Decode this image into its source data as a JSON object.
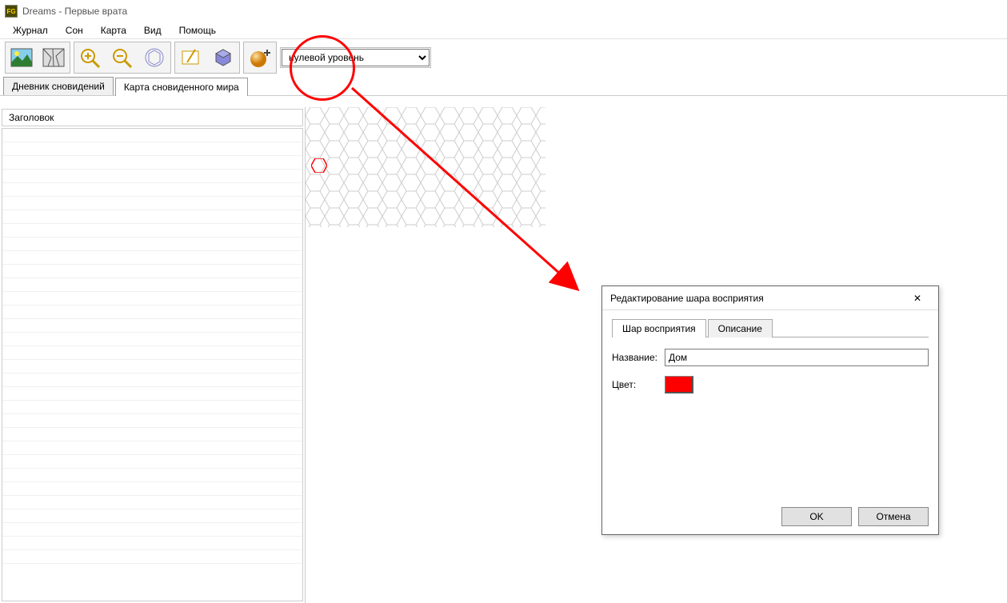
{
  "window": {
    "title": "Dreams - Первые врата"
  },
  "menu": {
    "items": [
      "Журнал",
      "Сон",
      "Карта",
      "Вид",
      "Помощь"
    ]
  },
  "toolbar": {
    "icons": [
      "picture-icon",
      "cracked-icon",
      "zoom-in-icon",
      "zoom-out-icon",
      "hex-grid-icon",
      "edit-icon",
      "hex-3d-icon",
      "sphere-add-icon"
    ],
    "level_dropdown": {
      "selected": "нулевой уровень"
    }
  },
  "doctabs": {
    "tabs": [
      {
        "label": "Дневник сновидений",
        "active": false
      },
      {
        "label": "Карта сновиденного мира",
        "active": true
      }
    ]
  },
  "sidebar": {
    "header": "Заголовок"
  },
  "dialog": {
    "title": "Редактирование шара восприятия",
    "tabs": [
      {
        "label": "Шар восприятия",
        "active": true
      },
      {
        "label": "Описание",
        "active": false
      }
    ],
    "name_label": "Название:",
    "name_value": "Дом",
    "color_label": "Цвет:",
    "color_value": "#ff0000",
    "ok": "OK",
    "cancel": "Отмена"
  }
}
